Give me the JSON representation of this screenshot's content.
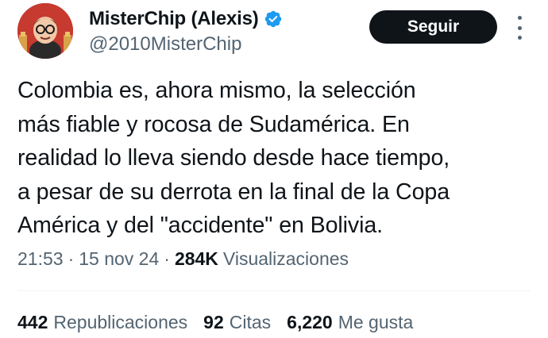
{
  "author": {
    "display_name": "MisterChip (Alexis)",
    "handle": "@2010MisterChip",
    "verified_icon": "verified-badge-icon",
    "avatar_colors": {
      "background": "#c63a2f",
      "face": "#f2c9a8",
      "glasses": "#1a1a1a"
    }
  },
  "actions": {
    "follow_label": "Seguir",
    "more_icon": "more-dots-icon"
  },
  "tweet": {
    "text": "Colombia es, ahora mismo, la selección\nmás fiable y rocosa de Sudamérica. En\nrealidad lo lleva siendo desde hace tiempo,\na pesar de su derrota en la final de la Copa\nAmérica y del \"accidente\" en Bolivia."
  },
  "meta": {
    "time": "21:53",
    "separator": "·",
    "date": "15 nov 24",
    "views_count": "284K",
    "views_label": "Visualizaciones"
  },
  "stats": {
    "reposts_count": "442",
    "reposts_label": "Republicaciones",
    "quotes_count": "92",
    "quotes_label": "Citas",
    "likes_count": "6,220",
    "likes_label": "Me gusta"
  },
  "colors": {
    "accent_verified": "#1d9bf0",
    "primary_text": "#0f1419",
    "secondary_text": "#536471",
    "button_bg": "#0f1419",
    "button_text": "#ffffff"
  }
}
